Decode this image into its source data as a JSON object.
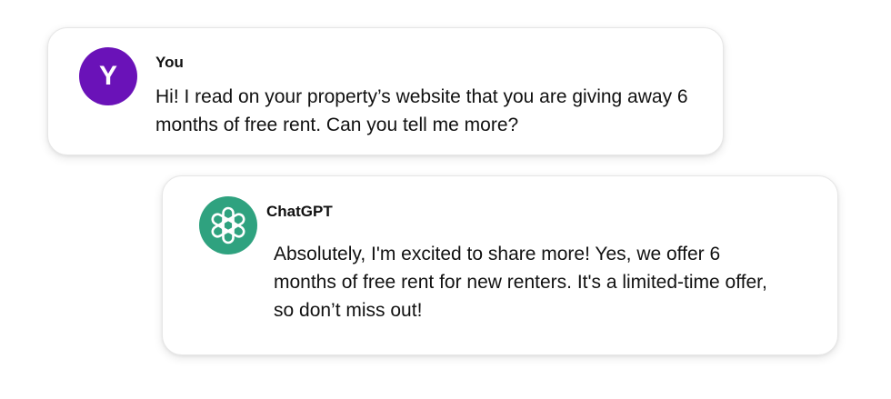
{
  "user_message": {
    "avatar_initial": "Y",
    "avatar_color": "#6a12b8",
    "sender": "You",
    "text": "Hi! I read on your property’s website that you are giving away 6 months of free rent. Can you tell me more?"
  },
  "bot_message": {
    "avatar_icon": "openai-logo-icon",
    "avatar_color": "#2fa27f",
    "sender": "ChatGPT",
    "text": "Absolutely, I'm excited to share more! Yes, we offer 6 months of free rent for new renters. It's a limited-time offer, so don’t miss out!"
  }
}
